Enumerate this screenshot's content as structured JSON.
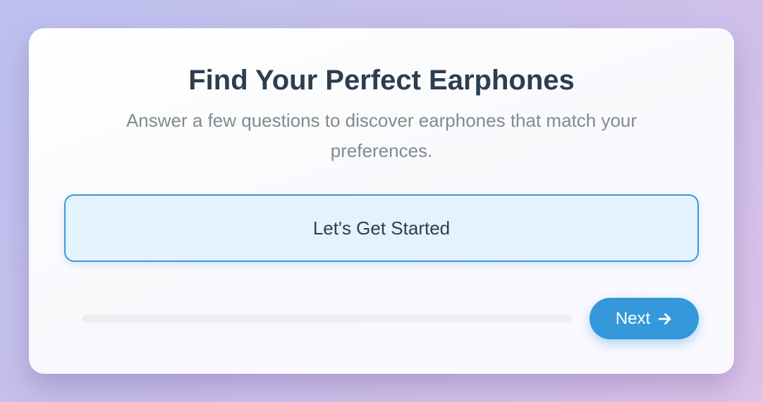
{
  "quiz": {
    "title": "Find Your Perfect Earphones",
    "subtitle": "Answer a few questions to discover earphones that match your preferences.",
    "option_label": "Let's Get Started",
    "progress": 0,
    "next_label": "Next",
    "next_icon": "arrow-right-icon"
  },
  "colors": {
    "accent": "#3498db",
    "title": "#2c3e50",
    "subtitle": "#7f8c8d",
    "option_bg": "#e3f2fc",
    "track": "#ecf0f1"
  }
}
